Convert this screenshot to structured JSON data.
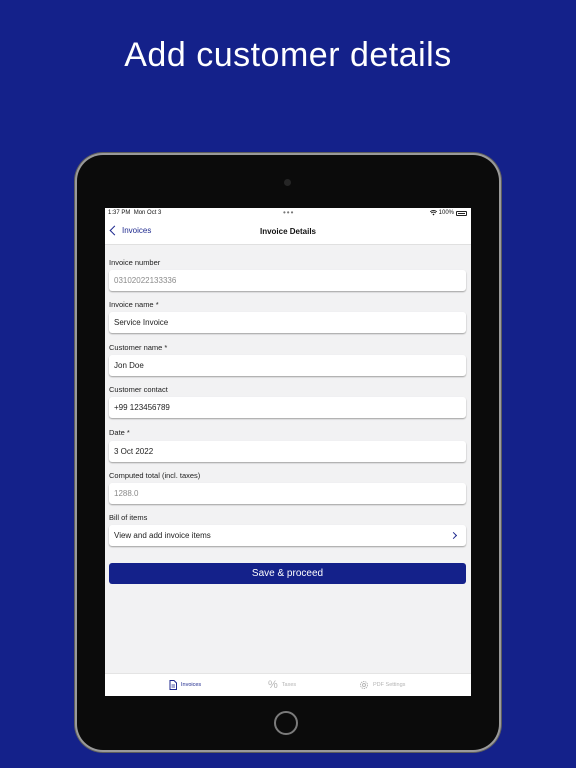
{
  "headline": "Add customer details",
  "status_bar": {
    "time": "1:37 PM",
    "date": "Mon Oct 3",
    "multitask_dots": "•••",
    "battery": "100%"
  },
  "navbar": {
    "back_label": "Invoices",
    "title": "Invoice Details"
  },
  "form": {
    "invoice_number": {
      "label": "Invoice number",
      "value": "03102022133336"
    },
    "invoice_name": {
      "label": "Invoice name *",
      "value": "Service Invoice"
    },
    "customer_name": {
      "label": "Customer name *",
      "value": "Jon Doe"
    },
    "customer_contact": {
      "label": "Customer contact",
      "value": "+99 123456789"
    },
    "date": {
      "label": "Date *",
      "value": "3 Oct 2022"
    },
    "computed_total": {
      "label": "Computed total (incl. taxes)",
      "value": "1288.0"
    },
    "bill_of_items": {
      "label": "Bill of items",
      "value": "View and add invoice items"
    }
  },
  "save_button": "Save & proceed",
  "tabs": [
    {
      "label": "Invoices",
      "icon": "document-icon",
      "active": true
    },
    {
      "label": "Taxes",
      "icon": "percent-icon",
      "active": false
    },
    {
      "label": "PDF Settings",
      "icon": "gear-icon",
      "active": false
    }
  ],
  "colors": {
    "background": "#14218a",
    "accent": "#1f2a8f"
  }
}
